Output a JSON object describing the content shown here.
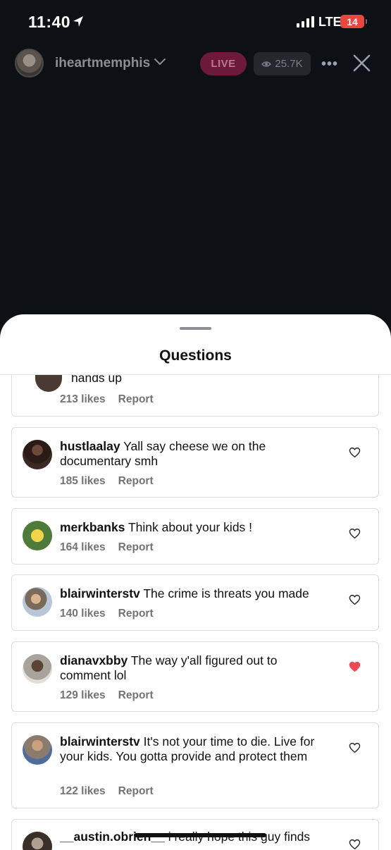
{
  "status_bar": {
    "time": "11:40",
    "network": "LTE",
    "battery": "14"
  },
  "live": {
    "host": "iheartmemphis",
    "live_label": "LIVE",
    "viewers": "25.7K",
    "more": "•••"
  },
  "sheet": {
    "title": "Questions"
  },
  "partial_top": {
    "text": "hands up",
    "likes": "213 likes",
    "report": "Report"
  },
  "questions": [
    {
      "user": "hustlaalay",
      "text": "Yall say cheese we on the documentary smh",
      "likes": "185 likes",
      "report": "Report",
      "liked": false
    },
    {
      "user": "merkbanks",
      "text": "Think about your kids !",
      "likes": "164 likes",
      "report": "Report",
      "liked": false
    },
    {
      "user": "blairwinterstv",
      "text": "The crime is threats you made",
      "likes": "140 likes",
      "report": "Report",
      "liked": false
    },
    {
      "user": "dianavxbby",
      "text": "The way y'all figured out to comment lol",
      "likes": "129 likes",
      "report": "Report",
      "liked": true
    },
    {
      "user": "blairwinterstv",
      "text": "It's not your time to die. Live for your kids. You gotta provide and protect them",
      "likes": "122 likes",
      "report": "Report",
      "liked": false
    },
    {
      "user": "__austin.obrien__",
      "text": "i really hope this guy finds"
    }
  ],
  "colors": {
    "heart_liked": "#ed4956",
    "live_badge": "#6d1a3a"
  }
}
